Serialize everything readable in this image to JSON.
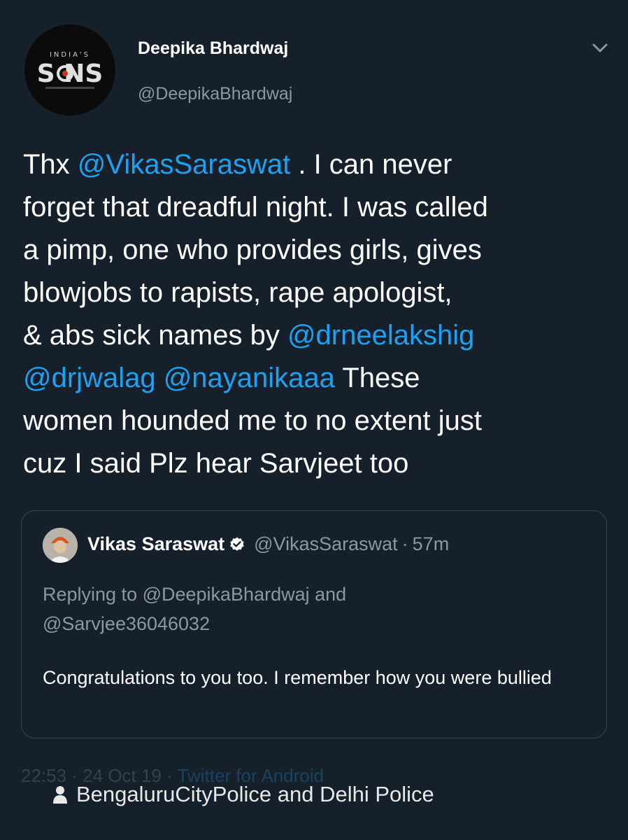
{
  "tweet": {
    "author": {
      "avatar_logo_text": "INDIA'S SONS",
      "display_name": "Deepika Bhardwaj",
      "handle": "@DeepikaBhardwaj"
    },
    "menu_icon": "chevron-down-icon",
    "body": {
      "line1_a": "Thx ",
      "line1_mention": "@VikasSaraswat",
      "line1_b": " . I can never",
      "line2": "forget that dreadful night. I was called",
      "line3": "a pimp, one who provides girls, gives",
      "line4": "blowjobs to rapists, rape apologist,",
      "line5_a": "& abs sick names by ",
      "line5_mention": "@drneelakshig",
      "line6_mention1": "@drjwalag",
      "line6_mention2": "@nayanikaaa",
      "line6_b": " These",
      "line7": "women hounded me to no extent just",
      "line8": "cuz I said Plz hear Sarvjeet too"
    },
    "quoted": {
      "display_name": "Vikas Saraswat",
      "verified_icon": "verified-badge-icon",
      "handle": "@VikasSaraswat",
      "separator": "·",
      "time": "57m",
      "reply_line1": "Replying to @DeepikaBhardwaj and",
      "reply_line2": "@Sarvjee36046032",
      "text": "Congratulations to you too. I remember how you were bullied"
    },
    "meta": {
      "time_date": "22:53 · 24 Oct 19 · ",
      "source": "Twitter for Android"
    }
  },
  "share_overlay": {
    "icon": "person-icon",
    "text": "BengaluruCityPolice and Delhi Police"
  },
  "colors": {
    "background": "#15202b",
    "mention": "#1da1f2",
    "secondary_text": "#8899a6",
    "border": "#38444d",
    "verified": "#ffffff"
  }
}
